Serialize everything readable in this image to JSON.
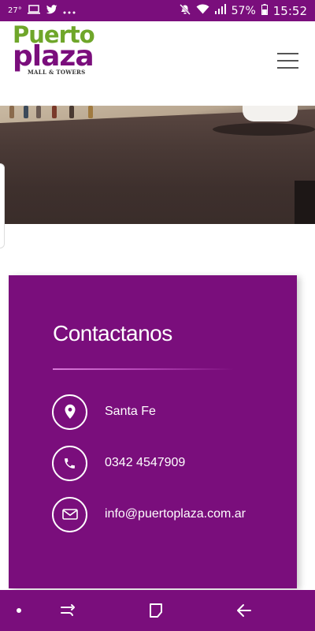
{
  "status_bar": {
    "temperature": "27°",
    "battery_percent": "57%",
    "time": "15:52",
    "icons": [
      "laptop-icon",
      "twitter-icon",
      "more-icon",
      "mute-icon",
      "wifi-icon",
      "signal-icon",
      "battery-icon"
    ]
  },
  "header": {
    "logo": {
      "line1": "Puerto",
      "line2": "plaza",
      "tagline": "MALL & TOWERS"
    },
    "menu_icon": "hamburger-menu-icon"
  },
  "contact": {
    "title": "Contactanos",
    "items": [
      {
        "icon": "location-pin-icon",
        "text": "Santa Fe"
      },
      {
        "icon": "phone-icon",
        "text": "0342 4547909"
      },
      {
        "icon": "mail-icon",
        "text": "info@puertoplaza.com.ar"
      }
    ]
  },
  "nav_bar": {
    "icons": [
      "dot-icon",
      "recent-apps-icon",
      "home-icon",
      "back-icon"
    ]
  },
  "colors": {
    "brand_purple": "#7a0e7c",
    "brand_green": "#6fa62a",
    "divider": "#d97bd9"
  }
}
